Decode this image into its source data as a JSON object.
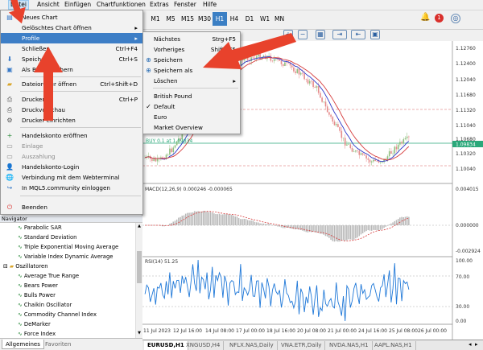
{
  "menubar": {
    "items": [
      "Datei",
      "Ansicht",
      "Einfügen",
      "Chartfunktionen",
      "Extras",
      "Fenster",
      "Hilfe"
    ]
  },
  "toolbar": {
    "timeframes": [
      "M1",
      "M5",
      "M15",
      "M30",
      "H1",
      "H4",
      "D1",
      "W1",
      "MN"
    ],
    "active_timeframe": "H1",
    "notification_count": "1"
  },
  "file_menu": {
    "items": [
      {
        "label": "Neues Chart",
        "shortcut": "",
        "icon": "new-chart-icon",
        "state": "normal"
      },
      {
        "label": "Gelöschtes Chart öffnen",
        "shortcut": "",
        "icon": "",
        "state": "normal",
        "submenu": true
      },
      {
        "label": "Profile",
        "shortcut": "",
        "icon": "",
        "state": "highlighted",
        "submenu": true
      },
      {
        "label": "Schließen",
        "shortcut": "Ctrl+F4",
        "icon": "",
        "state": "normal"
      },
      {
        "label": "Speichern",
        "shortcut": "Ctrl+S",
        "icon": "save-icon",
        "state": "normal"
      },
      {
        "label": "Als Bild speichern",
        "shortcut": "",
        "icon": "image-icon",
        "state": "normal"
      },
      {
        "label": "Dateiordner öffnen",
        "shortcut": "Ctrl+Shift+D",
        "icon": "folder-icon",
        "state": "normal"
      },
      {
        "label": "Drucken",
        "shortcut": "Ctrl+P",
        "icon": "print-icon",
        "state": "normal"
      },
      {
        "label": "Druckvorschau",
        "shortcut": "",
        "icon": "print-preview-icon",
        "state": "normal"
      },
      {
        "label": "Drucker einrichten",
        "shortcut": "",
        "icon": "printer-setup-icon",
        "state": "normal"
      },
      {
        "label": "Handelskonto eröffnen",
        "shortcut": "",
        "icon": "account-open-icon",
        "state": "normal"
      },
      {
        "label": "Einlage",
        "shortcut": "",
        "icon": "deposit-icon",
        "state": "disabled"
      },
      {
        "label": "Auszahlung",
        "shortcut": "",
        "icon": "withdraw-icon",
        "state": "disabled"
      },
      {
        "label": "Handelskonto-Login",
        "shortcut": "",
        "icon": "login-icon",
        "state": "normal"
      },
      {
        "label": "Verbindung mit dem Webterminal",
        "shortcut": "",
        "icon": "web-terminal-icon",
        "state": "normal"
      },
      {
        "label": "In MQL5.community einloggen",
        "shortcut": "",
        "icon": "mql5-icon",
        "state": "normal"
      },
      {
        "label": "Beenden",
        "shortcut": "",
        "icon": "exit-icon",
        "state": "normal"
      }
    ]
  },
  "profile_menu": {
    "items": [
      {
        "label": "Nächstes",
        "shortcut": "Strg+F5",
        "icon": ""
      },
      {
        "label": "Vorheriges",
        "shortcut": "Shift+F5",
        "icon": ""
      },
      {
        "label": "Speichern",
        "shortcut": "",
        "icon": "save-icon"
      },
      {
        "label": "Speichern als",
        "shortcut": "",
        "icon": "save-as-icon"
      },
      {
        "label": "Löschen",
        "shortcut": "",
        "icon": "",
        "submenu": true
      },
      {
        "label": "British Pound",
        "shortcut": "",
        "icon": ""
      },
      {
        "label": "Default",
        "shortcut": "",
        "icon": "check-icon"
      },
      {
        "label": "Euro",
        "shortcut": "",
        "icon": ""
      },
      {
        "label": "Market Overview",
        "shortcut": "",
        "icon": ""
      }
    ]
  },
  "navigator": {
    "title": "Navigator",
    "items": [
      {
        "label": "Parabolic SAR",
        "level": 2
      },
      {
        "label": "Standard Deviation",
        "level": 2
      },
      {
        "label": "Triple Exponential Moving Average",
        "level": 2
      },
      {
        "label": "Variable Index Dynamic Average",
        "level": 2
      },
      {
        "label": "Oszillatoren",
        "level": 1
      },
      {
        "label": "Average True Range",
        "level": 2
      },
      {
        "label": "Bears Power",
        "level": 2
      },
      {
        "label": "Bulls Power",
        "level": 2
      },
      {
        "label": "Chaikin Oscillator",
        "level": 2
      },
      {
        "label": "Commodity Channel Index",
        "level": 2
      },
      {
        "label": "DeMarker",
        "level": 2
      },
      {
        "label": "Force Index",
        "level": 2
      }
    ],
    "tabs": [
      "Allgemeines",
      "Favoriten"
    ],
    "active_tab": "Allgemeines"
  },
  "chart": {
    "trade_label": "BUY 0.1 at 1.09834",
    "price_axis": [
      "1.12760",
      "1.12400",
      "1.12040",
      "1.11680",
      "1.11320",
      "1.11040",
      "1.10680",
      "1.10320",
      "1.10040"
    ],
    "current_price": "1.09834",
    "macd_label": "MACD(12,26,9) 0.000246 -0.000065",
    "macd_axis": [
      "0.004015",
      "0.000000",
      "-0.002924"
    ],
    "rsi_label": "RSI(14) 51.25",
    "rsi_axis": [
      "100.00",
      "70.00",
      "30.00",
      "0.00"
    ],
    "time_axis": [
      "11 Jul 2023",
      "12 Jul 16:00",
      "14 Jul 08:00",
      "17 Jul 00:00",
      "18 Jul 16:00",
      "20 Jul 08:00",
      "21 Jul 00:00",
      "24 Jul 16:00",
      "25 Jul 08:00",
      "26 Jul 00:00"
    ],
    "tabs": [
      "EURUSD,H1",
      "XNGUSD,H4",
      "NFLX.NAS,Daily",
      "VNA.ETR,Daily",
      "NVDA.NAS,H1",
      "AAPL.NAS,H1"
    ],
    "active_tab": "EURUSD,H1"
  },
  "colors": {
    "highlight": "#3d7ec6",
    "annotation_arrow": "#e8422c",
    "bull_candle": "#8fbf7f",
    "bear_candle": "#e58a8a",
    "ma_blue": "#2a35c8",
    "ma_red": "#d63c3c",
    "rsi_line": "#1f78d8"
  }
}
